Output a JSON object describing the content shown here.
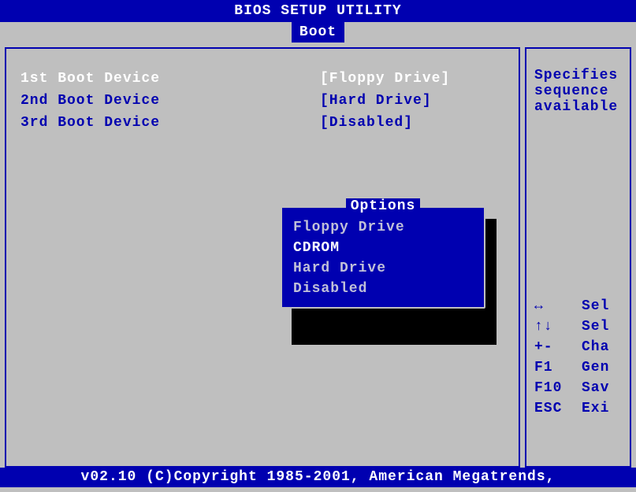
{
  "header": {
    "title": "BIOS SETUP UTILITY"
  },
  "tabs": {
    "active": "Boot"
  },
  "boot": {
    "rows": [
      {
        "label": "1st Boot Device",
        "value": "[Floppy Drive]"
      },
      {
        "label": "2nd Boot Device",
        "value": "[Hard Drive]"
      },
      {
        "label": "3rd Boot Device",
        "value": "[Disabled]"
      }
    ]
  },
  "popup": {
    "title": "Options",
    "items": [
      {
        "label": "Floppy Drive"
      },
      {
        "label": "CDROM"
      },
      {
        "label": "Hard Drive"
      },
      {
        "label": "Disabled"
      }
    ],
    "selected_index": 1
  },
  "side": {
    "desc_lines": [
      "Specifies",
      "sequence",
      "available"
    ],
    "help": [
      {
        "key": "↔",
        "text": "Sel"
      },
      {
        "key": "↑↓",
        "text": "Sel"
      },
      {
        "key": "+-",
        "text": "Cha"
      },
      {
        "key": "F1",
        "text": "Gen"
      },
      {
        "key": "F10",
        "text": "Sav"
      },
      {
        "key": "ESC",
        "text": "Exi"
      }
    ]
  },
  "footer": {
    "text": "v02.10 (C)Copyright 1985-2001, American Megatrends,"
  }
}
